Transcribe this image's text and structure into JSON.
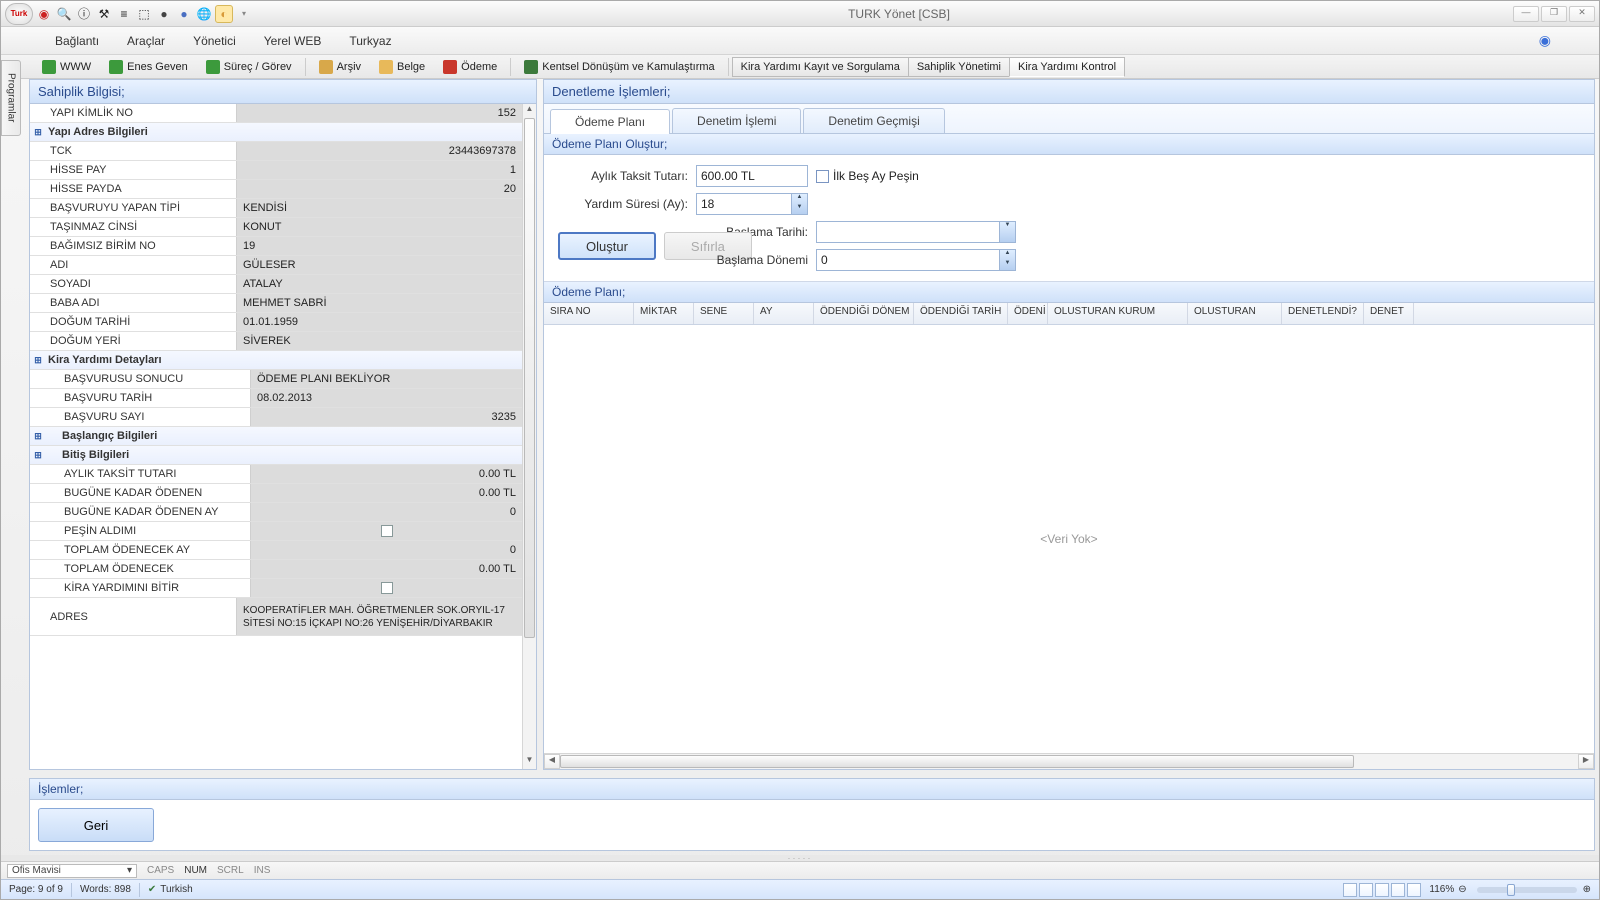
{
  "window": {
    "title": "TURK Yönet [CSB]"
  },
  "toolbar": {
    "orb": "Turk",
    "icons": [
      "C",
      "🔍",
      "ⓘ",
      "⚒",
      "≡",
      "⬚",
      "●",
      "●",
      "🌐",
      "◐"
    ]
  },
  "menubar": [
    "Bağlantı",
    "Araçlar",
    "Yönetici",
    "Yerel WEB",
    "Turkyaz"
  ],
  "sidebar_tab": "Programlar",
  "subtoolbar": {
    "buttons": [
      {
        "icon": "#3c9a3c",
        "label": "WWW"
      },
      {
        "icon": "#3c9a3c",
        "label": "Enes Geven"
      },
      {
        "icon": "#3c9a3c",
        "label": "Süreç / Görev"
      },
      {
        "icon": "#d8a84a",
        "label": "Arşiv"
      },
      {
        "icon": "#e8b95a",
        "label": "Belge"
      },
      {
        "icon": "#c9372c",
        "label": "Ödeme"
      },
      {
        "icon": "#3c7a3c",
        "label": "Kentsel Dönüşüm ve Kamulaştırma"
      }
    ],
    "tabs": [
      "Kira Yardımı Kayıt ve Sorgulama",
      "Sahiplik Yönetimi",
      "Kira Yardımı Kontrol"
    ],
    "active_tab": 2
  },
  "left_panel": {
    "title": "Sahiplik Bilgisi;",
    "rows": [
      {
        "t": "kv",
        "l": "YAPI KİMLİK NO",
        "v": "152",
        "align": "r"
      },
      {
        "t": "sect",
        "l": "Yapı Adres Bilgileri"
      },
      {
        "t": "kv",
        "l": "TCK",
        "v": "23443697378",
        "align": "r"
      },
      {
        "t": "kv",
        "l": "HİSSE PAY",
        "v": "1",
        "align": "r"
      },
      {
        "t": "kv",
        "l": "HİSSE PAYDA",
        "v": "20",
        "align": "r"
      },
      {
        "t": "kv",
        "l": "BAŞVURUYU YAPAN TİPİ",
        "v": "KENDİSİ"
      },
      {
        "t": "kv",
        "l": "TAŞINMAZ CİNSİ",
        "v": "KONUT"
      },
      {
        "t": "kv",
        "l": "BAĞIMSIZ BİRİM NO",
        "v": "19"
      },
      {
        "t": "kv",
        "l": "ADI",
        "v": "GÜLESER"
      },
      {
        "t": "kv",
        "l": "SOYADI",
        "v": "ATALAY"
      },
      {
        "t": "kv",
        "l": "BABA ADI",
        "v": "MEHMET SABRİ"
      },
      {
        "t": "kv",
        "l": "DOĞUM TARİHİ",
        "v": "01.01.1959"
      },
      {
        "t": "kv",
        "l": "DOĞUM YERİ",
        "v": "SİVEREK"
      },
      {
        "t": "sect",
        "l": "Kira Yardımı Detayları"
      },
      {
        "t": "kv",
        "l": "BAŞVURUSU SONUCU",
        "v": "ÖDEME PLANI BEKLİYOR",
        "ind": 1
      },
      {
        "t": "kv",
        "l": "BAŞVURU TARİH",
        "v": "08.02.2013",
        "ind": 1
      },
      {
        "t": "kv",
        "l": "BAŞVURU SAYI",
        "v": "3235",
        "align": "r",
        "ind": 1
      },
      {
        "t": "sect",
        "l": "Başlangıç Bilgileri",
        "ind": 1
      },
      {
        "t": "sect",
        "l": "Bitiş Bilgileri",
        "ind": 1
      },
      {
        "t": "kv",
        "l": "AYLIK TAKSİT TUTARI",
        "v": "0.00 TL",
        "align": "r",
        "ind": 1
      },
      {
        "t": "kv",
        "l": "BUGÜNE KADAR ÖDENEN",
        "v": "0.00 TL",
        "align": "r",
        "ind": 1
      },
      {
        "t": "kv",
        "l": "BUGÜNE KADAR ÖDENEN AY",
        "v": "0",
        "align": "r",
        "ind": 1
      },
      {
        "t": "chk",
        "l": "PEŞİN ALDIMI",
        "ind": 1
      },
      {
        "t": "kv",
        "l": "TOPLAM ÖDENECEK AY",
        "v": "0",
        "align": "r",
        "ind": 1
      },
      {
        "t": "kv",
        "l": "TOPLAM ÖDENECEK",
        "v": "0.00 TL",
        "align": "r",
        "ind": 1
      },
      {
        "t": "chk",
        "l": "KİRA YARDIMINI BİTİR",
        "ind": 1
      },
      {
        "t": "kv",
        "l": "ADRES",
        "v": "KOOPERATİFLER MAH. ÖĞRETMENLER SOK.ORYIL-17 SİTESİ  NO:15 İÇKAPI NO:26 YENİŞEHİR/DİYARBAKIR",
        "wrap": 1
      }
    ]
  },
  "right_panel": {
    "title": "Denetleme İşlemleri;",
    "tabs": [
      "Ödeme Planı",
      "Denetim İşlemi",
      "Denetim Geçmişi"
    ],
    "active_tab": 0,
    "form_title": "Ödeme Planı Oluştur;",
    "form": {
      "aylik_label": "Aylık Taksit Tutarı:",
      "aylik_value": "600.00 TL",
      "sure_label": "Yardım Süresi (Ay):",
      "sure_value": "18",
      "baslama_tarihi_label": "Başlama Tarihi:",
      "baslama_tarihi_value": "",
      "baslama_donemi_label": "Başlama Dönemi",
      "baslama_donemi_value": "0",
      "ilkbes_label": "İlk Beş Ay Peşin",
      "olustur": "Oluştur",
      "sifirla": "Sıfırla"
    },
    "grid_title": "Ödeme Planı;",
    "grid_cols": [
      "SIRA NO",
      "MİKTAR",
      "SENE",
      "AY",
      "ÖDENDİĞİ DÖNEM",
      "ÖDENDİĞİ TARİH",
      "ÖDENİ",
      "OLUSTURAN KURUM",
      "OLUSTURAN",
      "DENETLENDİ?",
      "DENET"
    ],
    "grid_empty": "<Veri Yok>"
  },
  "bottom": {
    "title": "İşlemler;",
    "geri": "Geri"
  },
  "status1": {
    "theme": "Ofis Mavisi",
    "inds": [
      "CAPS",
      "NUM",
      "SCRL",
      "INS"
    ],
    "on": 1
  },
  "status2": {
    "page": "Page: 9 of 9",
    "words": "Words: 898",
    "lang": "Turkish",
    "zoom": "116%"
  }
}
